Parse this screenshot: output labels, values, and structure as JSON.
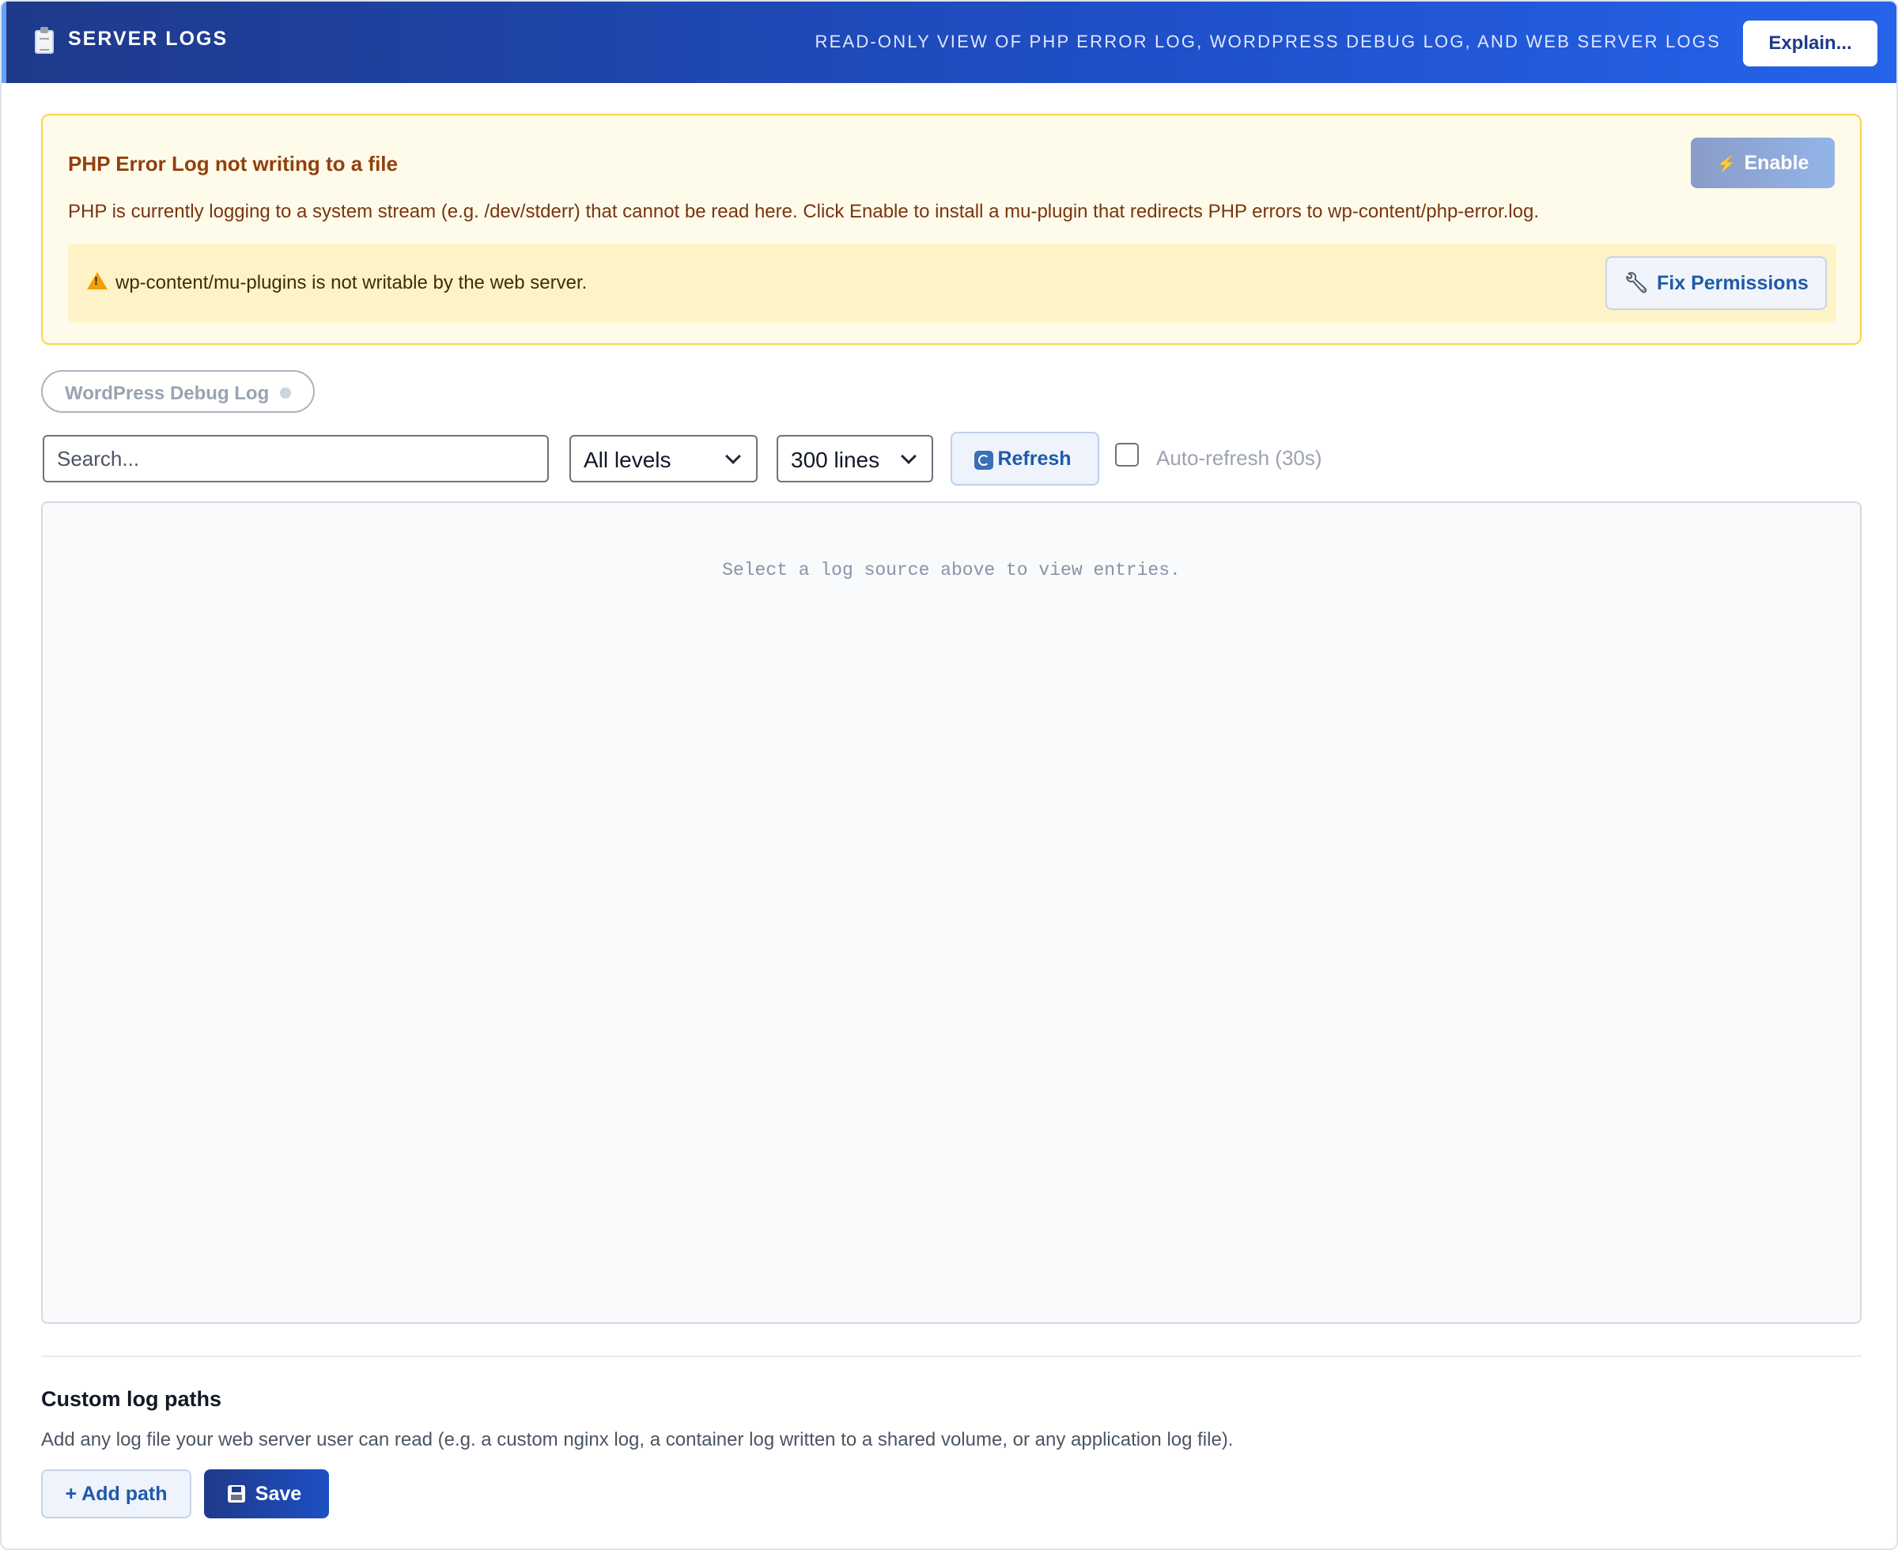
{
  "header": {
    "title": "SERVER LOGS",
    "subtitle": "READ-ONLY VIEW OF PHP ERROR LOG, WORDPRESS DEBUG LOG, AND WEB SERVER LOGS",
    "explain_label": "Explain..."
  },
  "notice": {
    "title": "PHP Error Log not writing to a file",
    "text": "PHP is currently logging to a system stream (e.g. /dev/stderr) that cannot be read here. Click Enable to install a mu-plugin that redirects PHP errors to wp-content/php-error.log.",
    "enable_label": "Enable",
    "warning_text": "wp-content/mu-plugins is not writable by the web server.",
    "fix_label": "Fix Permissions"
  },
  "sources": [
    {
      "label": "WordPress Debug Log"
    }
  ],
  "toolbar": {
    "search_placeholder": "Search...",
    "level_selected": "All levels",
    "lines_selected": "300 lines",
    "refresh_label": "Refresh",
    "auto_refresh_label": "Auto-refresh (30s)",
    "auto_refresh_checked": false
  },
  "log_viewer": {
    "empty_text": "Select a log source above to view entries."
  },
  "custom_paths": {
    "title": "Custom log paths",
    "description": "Add any log file your web server user can read (e.g. a custom nginx log, a container log written to a shared volume, or any application log file).",
    "add_label": "+ Add path",
    "save_label": "Save"
  },
  "colors": {
    "header_start": "#1e3a8a",
    "header_end": "#2563eb",
    "notice_bg": "#fffbea",
    "notice_border": "#fcd34d",
    "notice_title": "#92400e",
    "link_blue": "#1e5aa8"
  },
  "icons": {
    "header": "clipboard-icon",
    "enable": "lightning-icon",
    "warning": "warning-icon",
    "fix": "wrench-icon",
    "refresh": "refresh-icon",
    "save": "floppy-disk-icon"
  }
}
